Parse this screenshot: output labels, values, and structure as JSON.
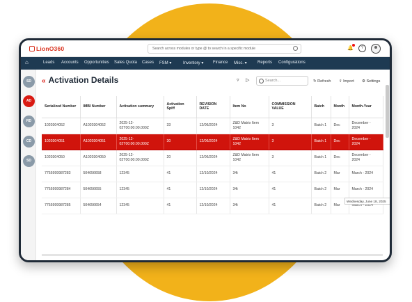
{
  "header": {
    "logo": "LionO360",
    "search_placeholder": "Search across modules or type @ to search in a specific module"
  },
  "nav": {
    "items": [
      "Leads",
      "Accounts",
      "Opportunities",
      "Sales Quota",
      "Cases",
      "FSM ▾",
      "Inventory ▾",
      "Finance",
      "Misc. ▾",
      "Reports",
      "Configurations"
    ]
  },
  "sidebar": {
    "badges": [
      "SD",
      "AD",
      "RD",
      "CD",
      "SD"
    ]
  },
  "page": {
    "title": "Activation Details",
    "search_placeholder": "Search...",
    "refresh_label": "Refresh",
    "import_label": "Import",
    "settings_label": "Settings"
  },
  "table": {
    "columns": [
      "Serialized Number",
      "IMBI Number",
      "Activation summary",
      "Activation Spiff",
      "REVISION DATE",
      "Item No",
      "COMMISSION VALUE",
      "Batch",
      "Month",
      "Month-Year"
    ],
    "rows": [
      [
        "1020304052",
        "A1020304052",
        "2025-12-02T00:00:00.000Z",
        "33",
        "12/06/2024",
        "Z&D Matrix Item 1042",
        "3",
        "Batch 1",
        "Dec",
        "December - 2024"
      ],
      [
        "1020304051",
        "A1020304051",
        "2025-12-02T00:00:00.000Z",
        "30",
        "12/06/2024",
        "Z&D Matrix Item 1042",
        "3",
        "Batch 1",
        "Dec",
        "December - 2024"
      ],
      [
        "1020304050",
        "A1020304050",
        "2025-12-02T00:00:00.000Z",
        "20",
        "12/06/2024",
        "Z&D Matrix Item 1042",
        "3",
        "Batch 1",
        "Dec",
        "December - 2024"
      ],
      [
        "7755999987283",
        "504656658",
        "12345",
        "41",
        "12/10/2024",
        "34t",
        "41",
        "Batch 2",
        "Mar",
        "March - 2024"
      ],
      [
        "7755999987284",
        "504656655",
        "12345",
        "41",
        "12/10/2024",
        "34t",
        "41",
        "Batch 2",
        "Mar",
        "March - 2024"
      ],
      [
        "7755999987285",
        "504656654",
        "12345",
        "41",
        "12/10/2024",
        "34t",
        "41",
        "Batch 2",
        "Mar",
        "March - 2024"
      ]
    ],
    "selected_row": 1
  },
  "tooltip": "Wednesday, June 18, 2025",
  "colors": {
    "accent": "#d0140c",
    "nav": "#1e3a52",
    "backdrop": "#f2b21a"
  }
}
